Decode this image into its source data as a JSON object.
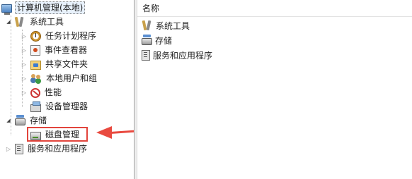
{
  "tree": {
    "root": {
      "label": "计算机管理(本地)",
      "icon": "computer-icon"
    },
    "system_tools": {
      "label": "系统工具",
      "icon": "tools-icon",
      "children": [
        {
          "label": "任务计划程序",
          "icon": "task-scheduler-icon"
        },
        {
          "label": "事件查看器",
          "icon": "event-viewer-icon"
        },
        {
          "label": "共享文件夹",
          "icon": "shared-folder-icon"
        },
        {
          "label": "本地用户和组",
          "icon": "users-icon"
        },
        {
          "label": "性能",
          "icon": "performance-icon"
        },
        {
          "label": "设备管理器",
          "icon": "device-manager-icon"
        }
      ]
    },
    "storage": {
      "label": "存储",
      "icon": "storage-icon",
      "children": [
        {
          "label": "磁盘管理",
          "icon": "disk-icon"
        }
      ]
    },
    "services": {
      "label": "服务和应用程序",
      "icon": "services-icon"
    }
  },
  "list": {
    "header": "名称",
    "items": [
      {
        "label": "系统工具",
        "icon": "tools-icon"
      },
      {
        "label": "存储",
        "icon": "storage-icon"
      },
      {
        "label": "服务和应用程序",
        "icon": "services-icon"
      }
    ]
  },
  "annotation": {
    "color": "#e94a3f"
  }
}
